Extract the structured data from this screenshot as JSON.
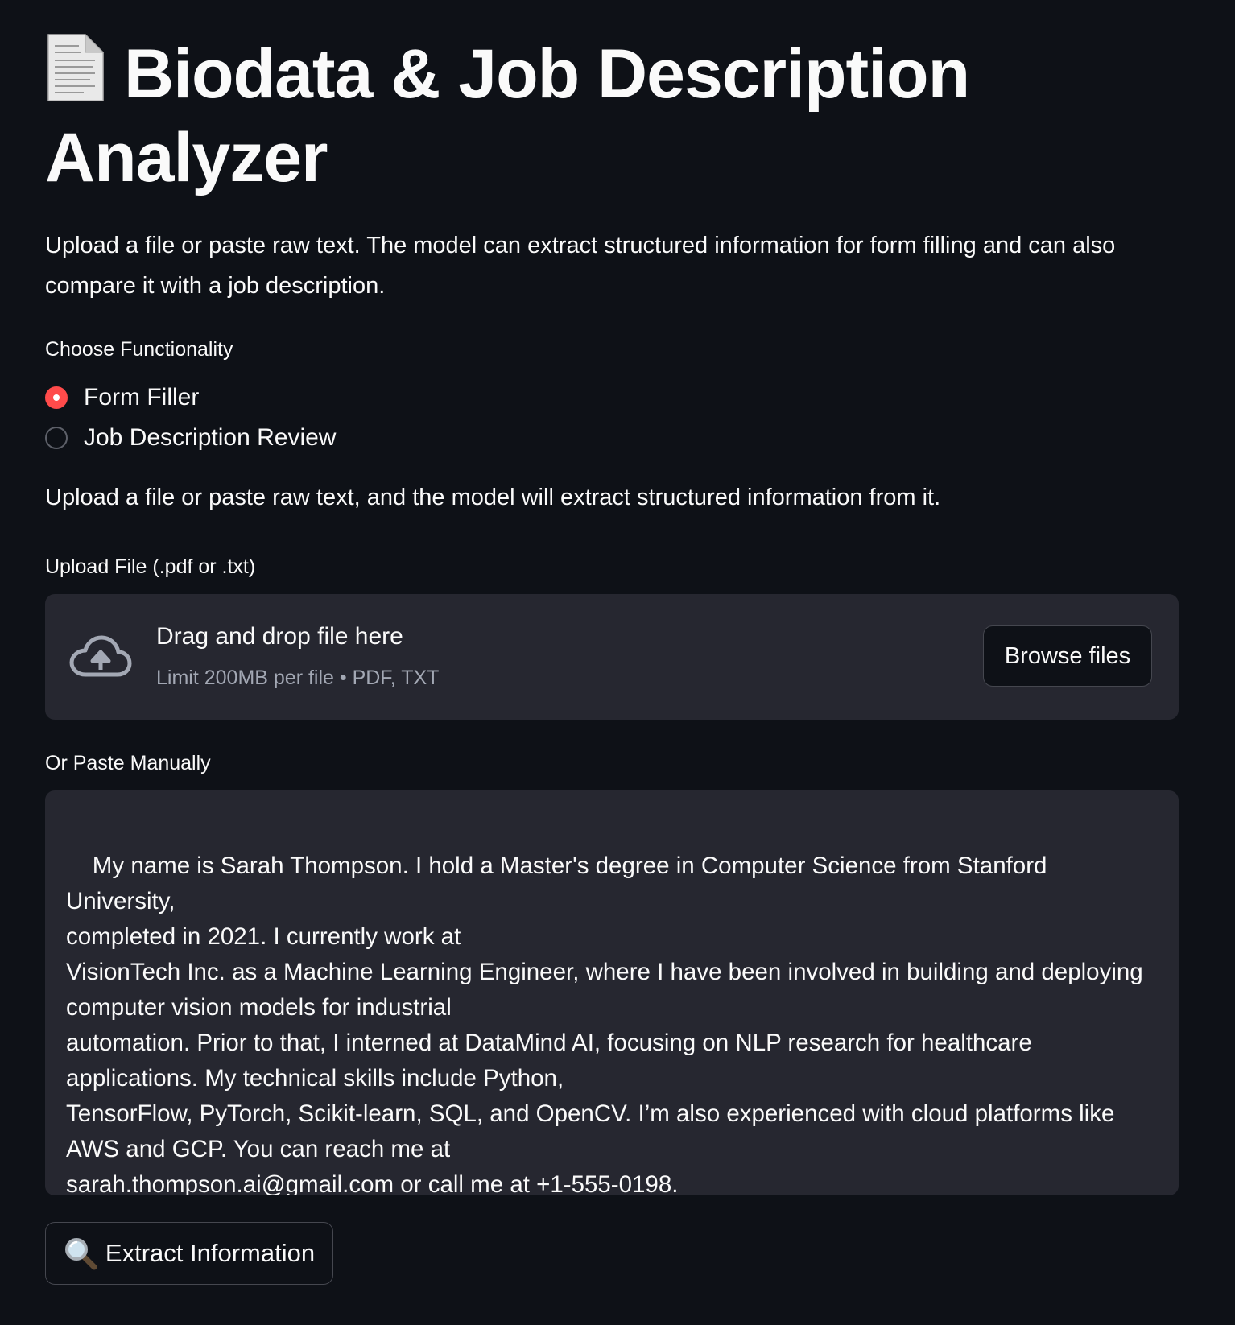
{
  "app": {
    "title": "Biodata & Job Description Analyzer",
    "title_icon": "page-document-icon",
    "intro": "Upload a file or paste raw text. The model can extract structured information for form filling and can also compare it with a job description."
  },
  "functionality": {
    "label": "Choose Functionality",
    "options": [
      {
        "label": "Form Filler",
        "selected": true
      },
      {
        "label": "Job Description Review",
        "selected": false
      }
    ],
    "accent_color": "#ff4b4b"
  },
  "helper_text": "Upload a file or paste raw text, and the model will extract structured information from it.",
  "upload": {
    "label": "Upload File (.pdf or .txt)",
    "icon": "cloud-upload-icon",
    "drop_title": "Drag and drop file here",
    "drop_subtitle": "Limit 200MB per file • PDF, TXT",
    "browse_label": "Browse files"
  },
  "paste": {
    "label": "Or Paste Manually",
    "value": "My name is Sarah Thompson. I hold a Master's degree in Computer Science from Stanford University,\ncompleted in 2021. I currently work at\nVisionTech Inc. as a Machine Learning Engineer, where I have been involved in building and deploying\ncomputer vision models for industrial\nautomation. Prior to that, I interned at DataMind AI, focusing on NLP research for healthcare\napplications. My technical skills include Python,\nTensorFlow, PyTorch, Scikit-learn, SQL, and OpenCV. I’m also experienced with cloud platforms like\nAWS and GCP. You can reach me at\nsarah.thompson.ai@gmail.com or call me at +1-555-0198."
  },
  "extract_button": {
    "label": "Extract Information",
    "icon": "magnifier-icon"
  }
}
